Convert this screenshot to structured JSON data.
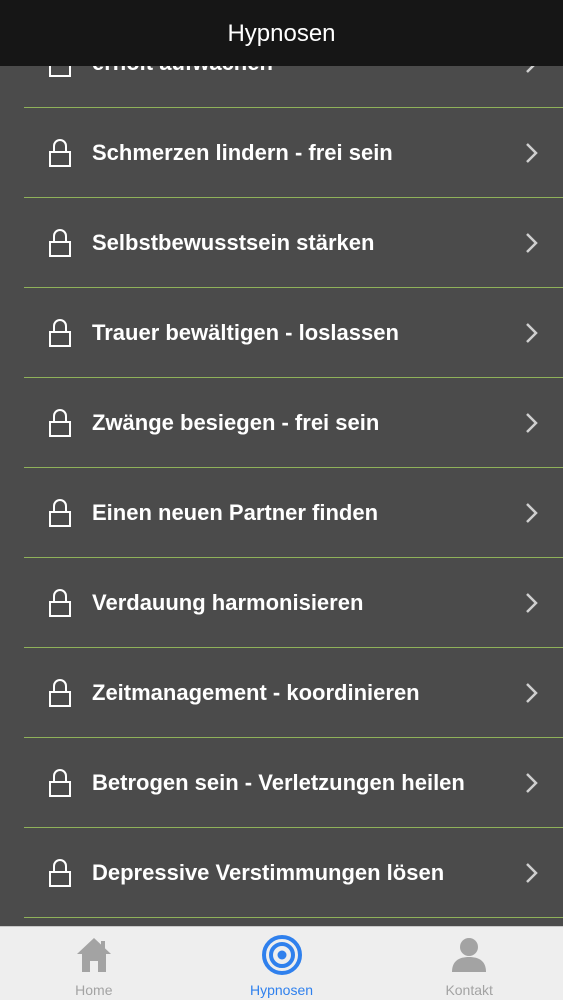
{
  "header": {
    "title": "Hypnosen"
  },
  "list": {
    "items": [
      {
        "label": "erholt aufwachen",
        "locked": true
      },
      {
        "label": "Schmerzen lindern - frei sein",
        "locked": true
      },
      {
        "label": "Selbstbewusstsein stärken",
        "locked": true
      },
      {
        "label": "Trauer bewältigen - loslassen",
        "locked": true
      },
      {
        "label": "Zwänge besiegen - frei sein",
        "locked": true
      },
      {
        "label": "Einen neuen Partner finden",
        "locked": true
      },
      {
        "label": "Verdauung harmonisieren",
        "locked": true
      },
      {
        "label": "Zeitmanagement - koordinieren",
        "locked": true
      },
      {
        "label": "Betrogen sein - Verletzungen heilen",
        "locked": true
      },
      {
        "label": "Depressive Verstimmungen lösen",
        "locked": true
      }
    ]
  },
  "tabs": [
    {
      "label": "Home",
      "icon": "home-icon",
      "active": false
    },
    {
      "label": "Hypnosen",
      "icon": "target-icon",
      "active": true
    },
    {
      "label": "Kontakt",
      "icon": "person-icon",
      "active": false
    }
  ],
  "colors": {
    "background": "#4b4b4b",
    "nav_bar": "#161616",
    "divider": "#8fb25a",
    "tab_bar": "#eeeeee",
    "tab_active": "#2f80ed",
    "tab_inactive": "#a3a3a3"
  }
}
